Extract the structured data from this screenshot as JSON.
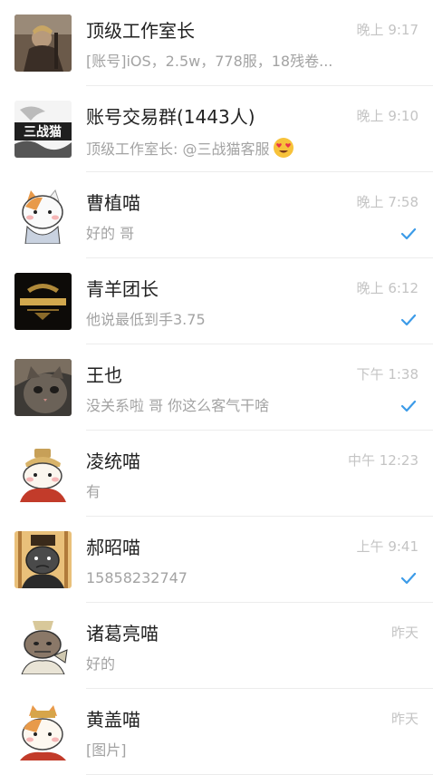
{
  "chats": [
    {
      "name": "顶级工作室长",
      "time": "晚上 9:17",
      "preview": "[账号]iOS，2.5w，778服，18残卷...",
      "read": false,
      "avatar": "warrior-portrait",
      "avatar_text": ""
    },
    {
      "name": "账号交易群(1443人)",
      "time": "晚上 9:10",
      "preview": "顶级工作室长: @三战猫客服",
      "read": false,
      "avatar": "game-logo",
      "avatar_text": "三战猫",
      "emoji": "heart-eyes-emoji"
    },
    {
      "name": "曹植喵",
      "time": "晚上 7:58",
      "preview": "好的 哥",
      "read": true,
      "avatar": "cat-cartoon"
    },
    {
      "name": "青羊团长",
      "time": "晚上 6:12",
      "preview": "他说最低到手3.75",
      "read": true,
      "avatar": "gold-logo"
    },
    {
      "name": "王也",
      "time": "下午 1:38",
      "preview": "没关系啦 哥 你这么客气干啥",
      "read": true,
      "avatar": "cat-photo"
    },
    {
      "name": "凌统喵",
      "time": "中午 12:23",
      "preview": "有",
      "read": false,
      "avatar": "cat-helmet"
    },
    {
      "name": "郝昭喵",
      "time": "上午 9:41",
      "preview": "15858232747",
      "read": true,
      "avatar": "cat-warrior"
    },
    {
      "name": "诸葛亮喵",
      "time": "昨天",
      "preview": "好的",
      "read": false,
      "avatar": "cat-scholar"
    },
    {
      "name": "黄盖喵",
      "time": "昨天",
      "preview": "[图片]",
      "read": false,
      "avatar": "cat-general"
    }
  ],
  "colors": {
    "check": "#3c9be8",
    "time": "#c4c4c4",
    "preview": "#a3a3a3"
  }
}
